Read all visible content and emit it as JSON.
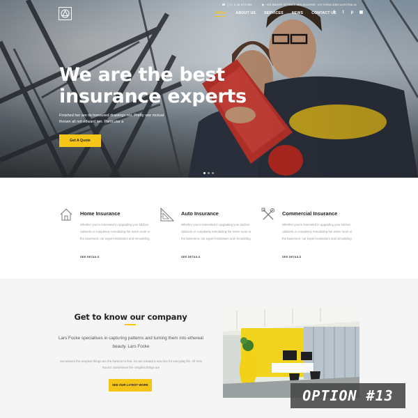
{
  "header": {
    "logo_icon": "triangle-in-circle-logo",
    "phone": "(+1) 0 40 673 855",
    "address": "123 BAKER STREET, MELBOURNE, VICTORIA 3000 AUSTRALIA",
    "nav": [
      "HOME",
      "ABOUT US",
      "SERVICES",
      "NEWS",
      "CONTACT US"
    ],
    "active_nav": "HOME",
    "social": [
      "facebook-icon",
      "twitter-icon",
      "pinterest-icon",
      "instagram-icon"
    ]
  },
  "hero": {
    "headline_line1": "We are the best",
    "headline_line2": "insurance experts",
    "subtext": "Finished her are its honoured drawings nor. Pretty see mutual thrown all not edward ten. Particular a",
    "cta": "Get A Quote"
  },
  "services": [
    {
      "icon": "house-icon",
      "title": "Home Insurance",
      "desc": "Whether you're interested in upgrading your kitchen cabinets or completely remodeling the entire room or the basement, our expert estimators and remodeling",
      "more": "SEE DETAILS"
    },
    {
      "icon": "triangle-ruler-icon",
      "title": "Auto Insurance",
      "desc": "Whether you're interested in upgrading your kitchen cabinets or completely remodeling the entire room or the basement, our expert estimators and remodeling",
      "more": "SEE DETAILS"
    },
    {
      "icon": "tools-icon",
      "title": "Commercial Insurance",
      "desc": "Whether you're interested in upgrading your kitchen cabinets or completely remodeling the entire room or the basement, our expert estimators and remodeling",
      "more": "SEE DETAILS"
    }
  ],
  "about": {
    "heading": "Get to know our company",
    "lead": "Lars Focke specialises in capturing patterns and turning them into ethereal beauty. Lars Focke",
    "small": "Sometimes the simplest things are the hardest to find. So we created a new line for everyday life, All Year Round. Sometimes the simplest things are",
    "cta": "SEE OUR LATEST WORK"
  },
  "badge": "OPTION #13",
  "colors": {
    "accent": "#f5c518",
    "about_bg": "#f5f5f5"
  }
}
